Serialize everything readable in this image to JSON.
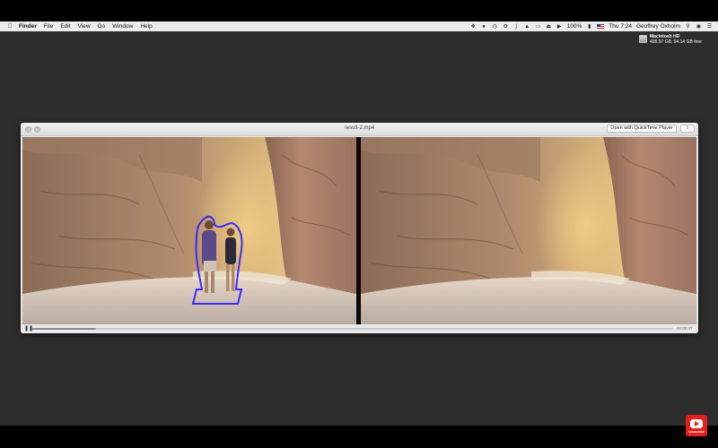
{
  "menubar": {
    "app": "Finder",
    "items": [
      "File",
      "Edit",
      "View",
      "Go",
      "Window",
      "Help"
    ],
    "battery": "100%",
    "clock": "Thu 7:24",
    "user": "Geoffrey Oxholm",
    "status_icons": [
      "dropbox-icon",
      "sync-icon",
      "clock-icon",
      "settings-icon",
      "bluetooth-icon",
      "wifi-icon",
      "display-icon",
      "eject-icon",
      "volume-icon",
      "battery-icon",
      "flag-icon",
      "search-icon",
      "siri-icon",
      "notification-center-icon"
    ]
  },
  "desktop": {
    "drive_name": "Macintosh HD",
    "drive_info": "498.97 GB, 94.14 GB free"
  },
  "window": {
    "title": "result-2.mp4",
    "open_with_label": "Open with QuickTime Player",
    "share_icon": "share-icon",
    "time_display": "00:00:07",
    "progress": 0.1
  },
  "video": {
    "left_panel": "original frame with selection outline around two people",
    "right_panel": "output frame with people removed",
    "outline_color": "#3b2bff"
  },
  "youtube": {
    "subscribe_label": "SUBSCRIBE"
  },
  "colors": {
    "desktop": "#2d2d2d",
    "menubar": "#ececec",
    "outline": "#3b2bff"
  }
}
